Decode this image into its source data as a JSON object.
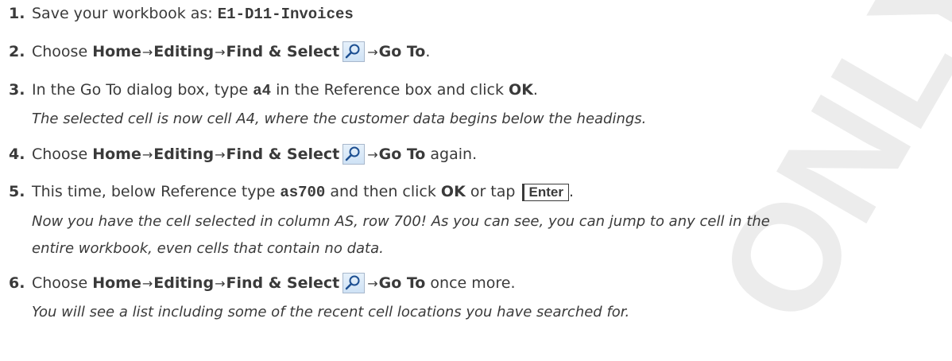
{
  "watermark": {
    "text": "ONLY",
    "color": "#ececec"
  },
  "steps": [
    {
      "num": "1.",
      "text": "Save your workbook as: ",
      "filename": "E1-D11-Invoices"
    },
    {
      "num": "2.",
      "prefix": "Choose ",
      "menu": [
        "Home",
        "Editing",
        "Find & Select"
      ],
      "icon": "magnifier-icon",
      "after_icon": "Go To",
      "suffix": "."
    },
    {
      "num": "3.",
      "text1": "In the Go To dialog box, type ",
      "code": "a4",
      "text2": " in the Reference box and click ",
      "bold": "OK",
      "suffix": "."
    },
    {
      "num": "4.",
      "prefix": "Choose ",
      "menu": [
        "Home",
        "Editing",
        "Find & Select"
      ],
      "icon": "magnifier-icon",
      "after_icon": "Go To",
      "suffix": " again."
    },
    {
      "num": "5.",
      "text1": "This time, below Reference type ",
      "code": "as700",
      "text2": " and then click ",
      "bold": "OK",
      "text3": " or tap ",
      "key": "Enter",
      "suffix": "."
    },
    {
      "num": "6.",
      "prefix": "Choose ",
      "menu": [
        "Home",
        "Editing",
        "Find & Select"
      ],
      "icon": "magnifier-icon",
      "after_icon": "Go To",
      "suffix": " once more."
    }
  ],
  "notes": {
    "after_step_3": "The selected cell is now cell A4, where the customer data begins below the headings.",
    "after_step_5_line1": "Now you have the cell selected in column AS, row 700! As you can see, you can jump to any cell in the",
    "after_step_5_line2": "entire workbook, even cells that contain no data.",
    "after_step_6": "You will see a list including some of the recent cell locations you have searched for."
  },
  "arrow_symbol": "→"
}
